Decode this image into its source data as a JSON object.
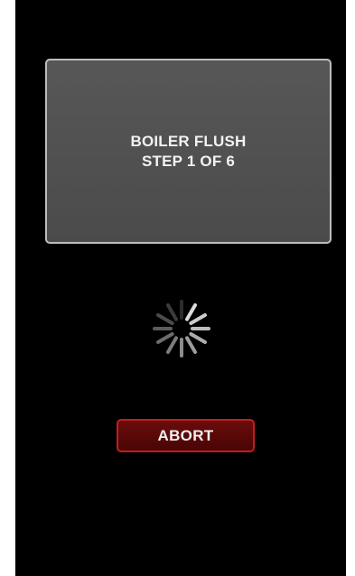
{
  "status_panel": {
    "line1": "BOILER FLUSH",
    "line2": "STEP 1 OF 6"
  },
  "spinner": {
    "icon": "loading-spinner-icon"
  },
  "abort_button": {
    "label": "ABORT"
  },
  "colors": {
    "background": "#000000",
    "panel": "#515151",
    "panel_border": "#bdbdbd",
    "abort_fill": "#5a0808",
    "abort_border": "#c21d1d",
    "text": "#f2f2f2"
  }
}
